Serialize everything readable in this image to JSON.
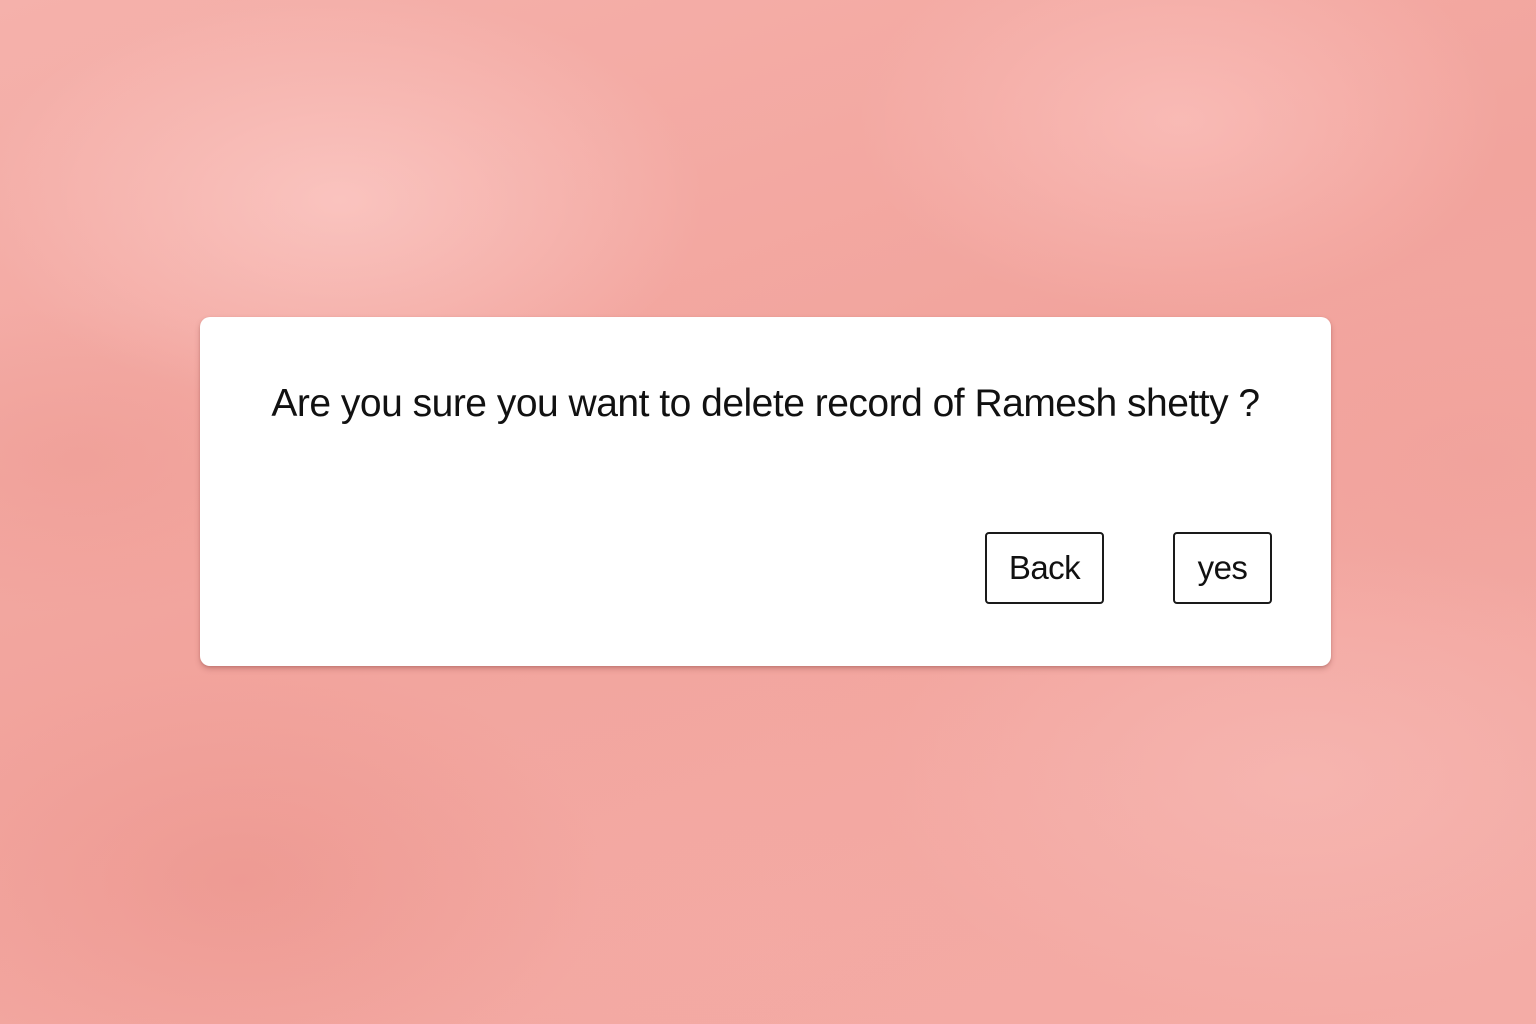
{
  "dialog": {
    "message": "Are you sure you want to delete record of Ramesh shetty ?",
    "back_label": "Back",
    "yes_label": "yes"
  },
  "colors": {
    "background": "#f3aaa4",
    "dialog": "#ffffff",
    "text": "#111111",
    "button_border": "#1a1a1a"
  }
}
